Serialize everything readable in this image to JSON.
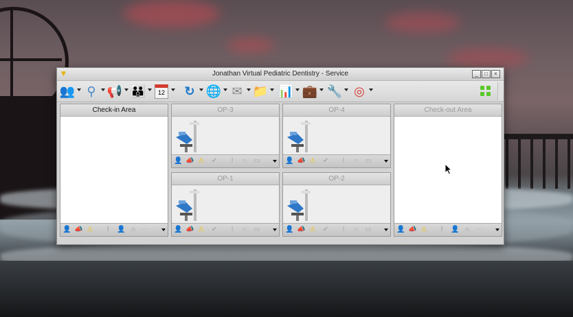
{
  "window": {
    "title": "Jonathan Virtual Pediatric Dentistry - Service",
    "app_icon": "dental-tooth-icon",
    "controls": [
      "minimize-icon",
      "maximize-icon",
      "close-icon"
    ]
  },
  "toolbar": {
    "buttons": [
      {
        "name": "patients",
        "icon": "people-icon",
        "dropdown": true
      },
      {
        "name": "broadcast",
        "icon": "antenna-icon",
        "dropdown": true
      },
      {
        "name": "announce",
        "icon": "megaphone-icon",
        "dropdown": true
      },
      {
        "name": "staff",
        "icon": "staff-group-icon",
        "dropdown": true
      },
      {
        "name": "calendar",
        "icon": "calendar-icon",
        "label": "12",
        "dropdown": true
      },
      {
        "name": "refresh",
        "icon": "refresh-icon",
        "dropdown": true
      },
      {
        "name": "web",
        "icon": "globe-icon",
        "dropdown": true
      },
      {
        "name": "mail",
        "icon": "envelope-icon",
        "dropdown": true
      },
      {
        "name": "files",
        "icon": "folder-icon",
        "dropdown": true
      },
      {
        "name": "reports",
        "icon": "bar-chart-icon",
        "dropdown": true
      },
      {
        "name": "toolkit",
        "icon": "briefcase-icon",
        "dropdown": true
      },
      {
        "name": "tools",
        "icon": "wrench-icon",
        "dropdown": true
      },
      {
        "name": "help",
        "icon": "lifebuoy-icon",
        "dropdown": true
      }
    ],
    "layout_icon": "grid-layout-icon"
  },
  "panels": {
    "checkin": {
      "label": "Check-in Area"
    },
    "op3": {
      "label": "OP-3"
    },
    "op4": {
      "label": "OP-4"
    },
    "checkout": {
      "label": "Check-out Area"
    },
    "op1": {
      "label": "OP-1"
    },
    "op2": {
      "label": "OP-2"
    }
  },
  "footer_icons": [
    "patient-icon",
    "megaphone-icon",
    "warning-icon",
    "check-icon",
    "info-icon",
    "user-icon",
    "bell-icon",
    "folder-icon"
  ],
  "colors": {
    "accent_blue": "#1f78c8",
    "warning": "#f2c200",
    "grid_green": "#59c82a"
  }
}
